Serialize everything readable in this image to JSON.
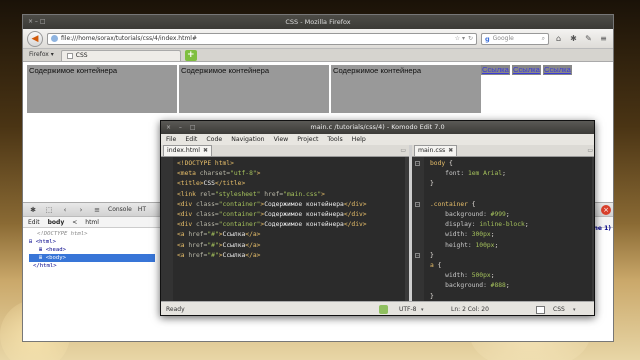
{
  "desktop": {
    "background": "#6b4c22"
  },
  "firefox": {
    "window_title": "CSS - Mozilla Firefox",
    "menu_button": "Firefox",
    "url": "file:///home/sorax/tutorials/css/4/index.html#",
    "search_placeholder": "Google",
    "search_badge": "g",
    "tab_title": "CSS",
    "new_tab": "+",
    "page": {
      "containers": [
        "Содержимое контейнера",
        "Содержимое контейнера",
        "Содержимое контейнера"
      ],
      "links": [
        "Ссылка",
        "Ссылка",
        "Ссылка"
      ],
      "container_color": "#999999",
      "link_bg_color": "#888888"
    }
  },
  "firebug": {
    "tabs": [
      "Console",
      "HT"
    ],
    "breadcrumb": {
      "edit": "Edit",
      "body": "body",
      "sep": "<",
      "html": "html"
    },
    "tree": [
      "<!DOCTYPE html>",
      "<html>",
      "<head>",
      "<body>",
      "</html>"
    ],
    "side_cut_text": "ine 1)"
  },
  "komodo": {
    "window_title": "main.c⁠ ⁠/tutorials/css/4) - Komodo Edit 7.0",
    "menu": [
      "File",
      "Edit",
      "Code",
      "Navigation",
      "View",
      "Project",
      "Tools",
      "Help"
    ],
    "left_tab": "index.html",
    "right_tab": "main.css",
    "status": {
      "ready": "Ready",
      "encoding": "UTF-8",
      "position": "Ln: 2 Col: 20",
      "language": "CSS"
    }
  }
}
